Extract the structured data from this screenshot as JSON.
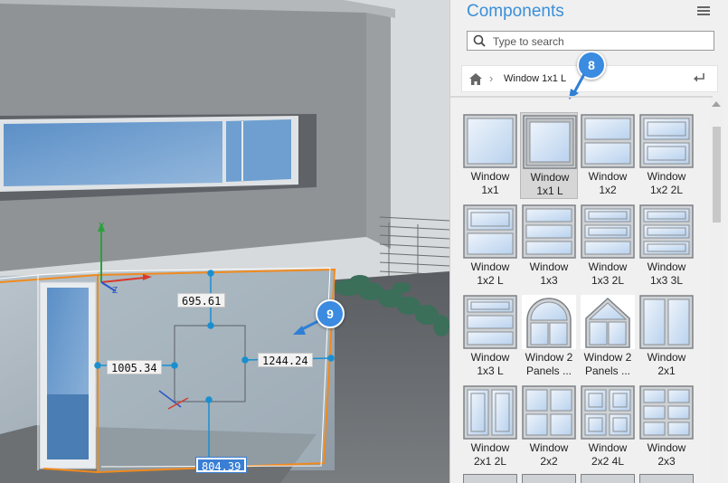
{
  "viewport": {
    "dimensions": {
      "height": "695.61",
      "left": "1005.34",
      "right": "1244.24",
      "bottom": "804.39"
    },
    "callouts": [
      "9"
    ]
  },
  "panel": {
    "title": "Components",
    "search": {
      "placeholder": "Type to search",
      "value": ""
    },
    "breadcrumb": {
      "current": "Window 1x1 L"
    },
    "callout": "8",
    "items": [
      {
        "label": "Window\n1x1",
        "icon": "window-1x1-icon",
        "selected": false
      },
      {
        "label": "Window\n1x1 L",
        "icon": "window-1x1-l-icon",
        "selected": true
      },
      {
        "label": "Window\n1x2",
        "icon": "window-1x2-icon",
        "selected": false
      },
      {
        "label": "Window\n1x2 2L",
        "icon": "window-1x2-2l-icon",
        "selected": false
      },
      {
        "label": "Window\n1x2 L",
        "icon": "window-1x2-l-icon",
        "selected": false
      },
      {
        "label": "Window\n1x3",
        "icon": "window-1x3-icon",
        "selected": false
      },
      {
        "label": "Window\n1x3 2L",
        "icon": "window-1x3-2l-icon",
        "selected": false
      },
      {
        "label": "Window\n1x3 3L",
        "icon": "window-1x3-3l-icon",
        "selected": false
      },
      {
        "label": "Window\n1x3 L",
        "icon": "window-1x3-l-icon",
        "selected": false
      },
      {
        "label": "Window 2\nPanels ...",
        "icon": "window-2-panels-arch-icon",
        "selected": false
      },
      {
        "label": "Window 2\nPanels ...",
        "icon": "window-2-panels-gable-icon",
        "selected": false
      },
      {
        "label": "Window\n2x1",
        "icon": "window-2x1-icon",
        "selected": false
      },
      {
        "label": "Window\n2x1 2L",
        "icon": "window-2x1-2l-icon",
        "selected": false
      },
      {
        "label": "Window\n2x2",
        "icon": "window-2x2-icon",
        "selected": false
      },
      {
        "label": "Window\n2x2 4L",
        "icon": "window-2x2-4l-icon",
        "selected": false
      },
      {
        "label": "Window\n2x3",
        "icon": "window-2x3-icon",
        "selected": false
      }
    ]
  }
}
